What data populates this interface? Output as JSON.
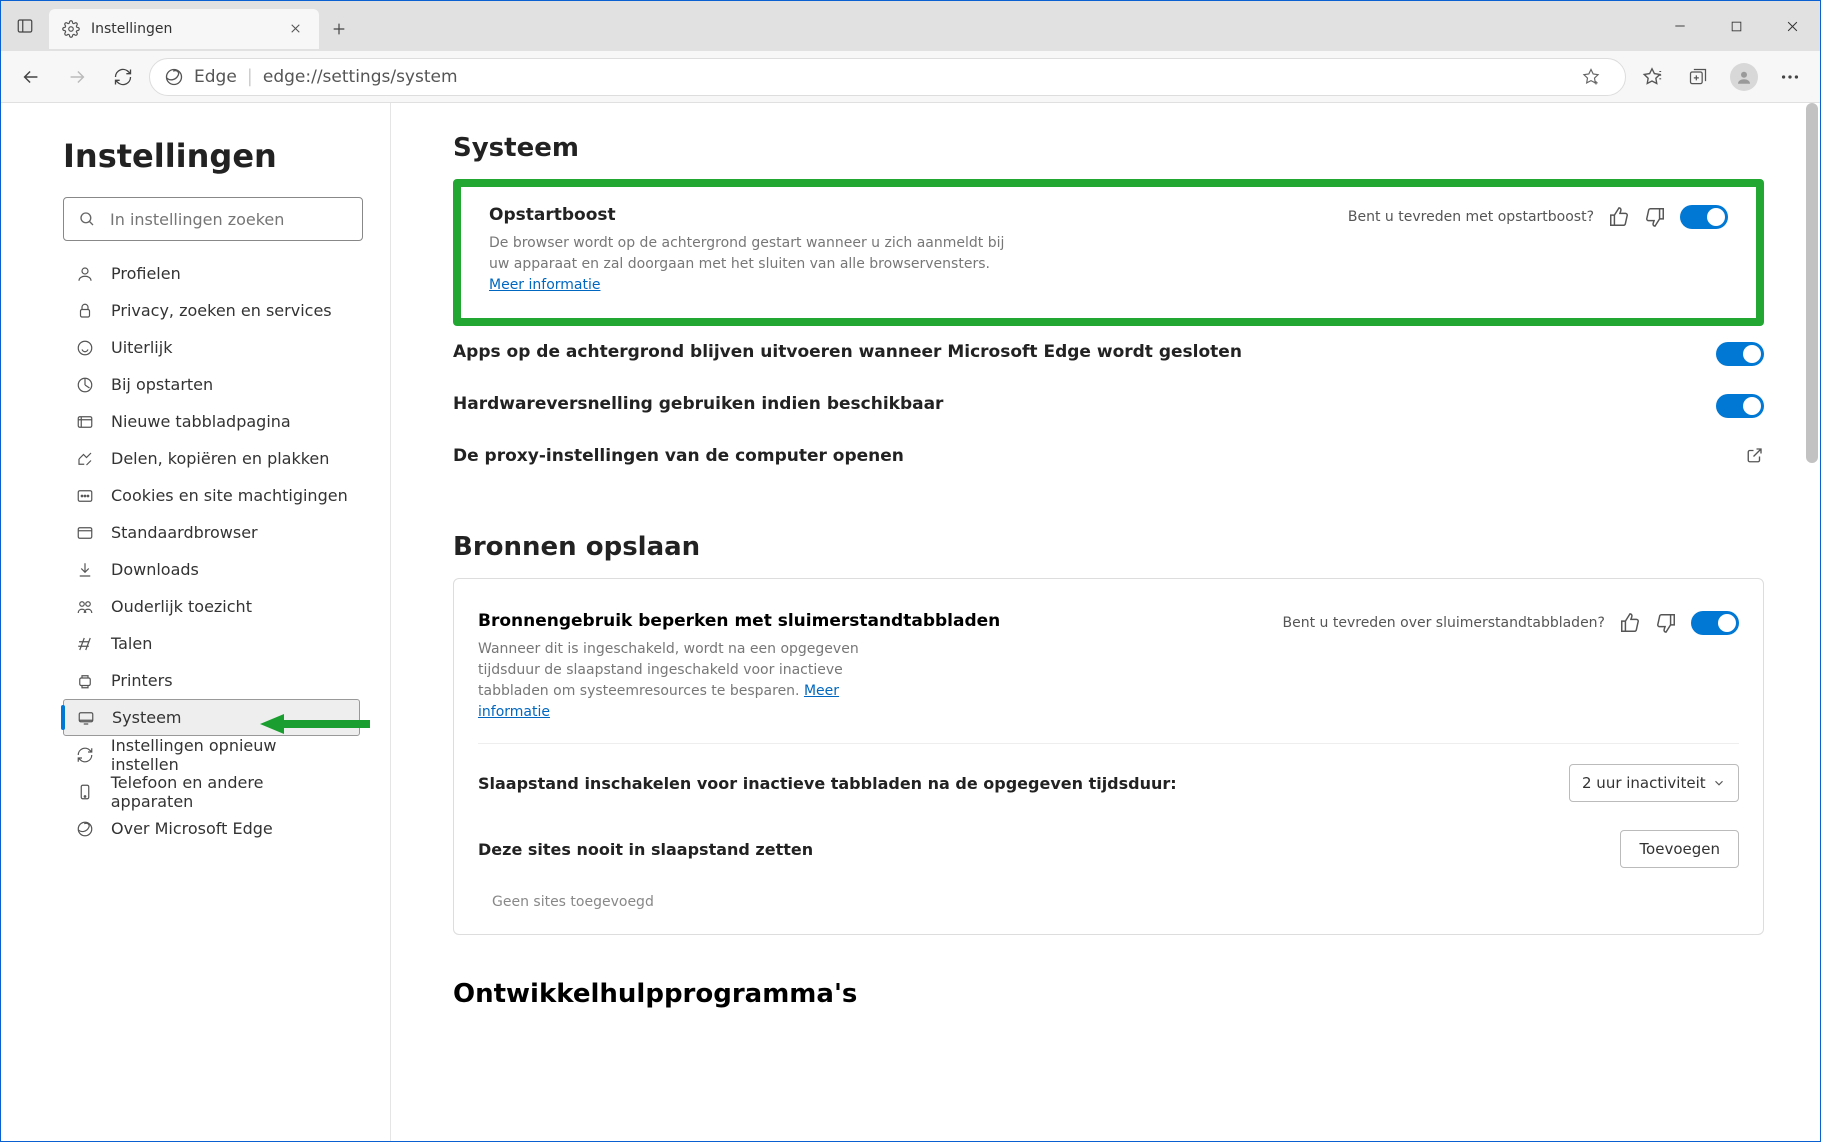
{
  "tab": {
    "title": "Instellingen"
  },
  "addressbar": {
    "scheme_label": "Edge",
    "url": "edge://settings/system"
  },
  "sidebar": {
    "title": "Instellingen",
    "search_placeholder": "In instellingen zoeken",
    "items": [
      "Profielen",
      "Privacy, zoeken en services",
      "Uiterlijk",
      "Bij opstarten",
      "Nieuwe tabbladpagina",
      "Delen, kopiëren en plakken",
      "Cookies en site machtigingen",
      "Standaardbrowser",
      "Downloads",
      "Ouderlijk toezicht",
      "Talen",
      "Printers",
      "Systeem",
      "Instellingen opnieuw instellen",
      "Telefoon en andere apparaten",
      "Over Microsoft Edge"
    ],
    "active_index": 12
  },
  "main": {
    "section1_title": "Systeem",
    "startup_boost": {
      "title": "Opstartboost",
      "desc": "De browser wordt op de achtergrond gestart wanneer u zich aanmeldt bij uw apparaat en zal doorgaan met het sluiten van alle browservensters. ",
      "link": "Meer informatie",
      "feedback_text": "Bent u tevreden met opstartboost?"
    },
    "bg_apps": "Apps op de achtergrond blijven uitvoeren wanneer Microsoft Edge wordt gesloten",
    "hw_accel": "Hardwareversnelling gebruiken indien beschikbaar",
    "proxy": "De proxy-instellingen van de computer openen",
    "section2_title": "Bronnen opslaan",
    "sleeping_tabs": {
      "title": "Bronnengebruik beperken met sluimerstandtabbladen",
      "desc": "Wanneer dit is ingeschakeld, wordt na een opgegeven tijdsduur de slaapstand ingeschakeld voor inactieve tabbladen om systeemresources te besparen. ",
      "link": "Meer informatie",
      "feedback_text": "Bent u tevreden over sluimerstandtabbladen?"
    },
    "sleep_timeout": {
      "label": "Slaapstand inschakelen voor inactieve tabbladen na de opgegeven tijdsduur:",
      "value": "2 uur inactiviteit"
    },
    "never_sleep": {
      "label": "Deze sites nooit in slaapstand zetten",
      "button": "Toevoegen",
      "empty": "Geen sites toegevoegd"
    },
    "section3_title": "Ontwikkelhulpprogramma's"
  }
}
